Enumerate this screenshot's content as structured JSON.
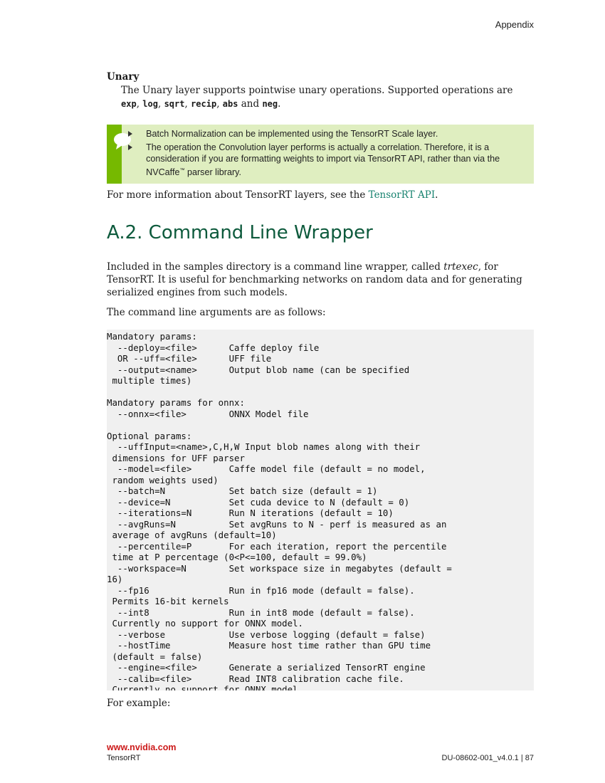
{
  "header": {
    "section": "Appendix"
  },
  "unary": {
    "title": "Unary",
    "text_before": "The Unary layer supports pointwise unary operations. Supported operations are ",
    "ops": [
      "exp",
      "log",
      "sqrt",
      "recip",
      "abs",
      "neg"
    ],
    "sep_1": ", ",
    "sep_2": ", ",
    "sep_3": ", ",
    "sep_4": ", ",
    "sep_and": " and ",
    "text_end": "."
  },
  "note": {
    "icon": "speech-bubble-icon",
    "colors": {
      "side": "#76b900",
      "background": "#dfeec0"
    },
    "bullet_1": "Batch Normalization can be implemented using the TensorRT Scale layer.",
    "bullet_2_before": "The operation the Convolution layer performs is actually a correlation. Therefore, it is a consideration if you are formatting weights to import via TensorRT API, rather than via the NVCaffe",
    "bullet_2_tm": "™",
    "bullet_2_after": " parser library."
  },
  "more_info": {
    "text": "For more information about TensorRT layers, see the ",
    "link": "TensorRT API",
    "end": "."
  },
  "section": {
    "title": "A.2. Command Line Wrapper",
    "intro_before": "Included in the samples directory is a command line wrapper, called ",
    "intro_tool": "trtexec",
    "intro_after": ", for TensorRT. It is useful for benchmarking networks on random data and for generating serialized engines from such models.",
    "args_intro": "The command line arguments are as follows:",
    "code": "Mandatory params:\n  --deploy=<file>      Caffe deploy file\n  OR --uff=<file>      UFF file\n  --output=<name>      Output blob name (can be specified\n multiple times)\n\nMandatory params for onnx:\n  --onnx=<file>        ONNX Model file\n\nOptional params:\n  --uffInput=<name>,C,H,W Input blob names along with their\n dimensions for UFF parser\n  --model=<file>       Caffe model file (default = no model,\n random weights used)\n  --batch=N            Set batch size (default = 1)\n  --device=N           Set cuda device to N (default = 0)\n  --iterations=N       Run N iterations (default = 10)\n  --avgRuns=N          Set avgRuns to N - perf is measured as an\n average of avgRuns (default=10)\n  --percentile=P       For each iteration, report the percentile\n time at P percentage (0<P<=100, default = 99.0%)\n  --workspace=N        Set workspace size in megabytes (default =\n16)\n  --fp16               Run in fp16 mode (default = false).\n Permits 16-bit kernels\n  --int8               Run in int8 mode (default = false).\n Currently no support for ONNX model.\n  --verbose            Use verbose logging (default = false)\n  --hostTime           Measure host time rather than GPU time\n (default = false)\n  --engine=<file>      Generate a serialized TensorRT engine\n  --calib=<file>       Read INT8 calibration cache file.\n Currently no support for ONNX model.",
    "example": "For example:"
  },
  "footer": {
    "site": "www.nvidia.com",
    "product": "TensorRT",
    "doc_id": "DU-08602-001_v4.0.1",
    "separator": " | ",
    "page": "87"
  }
}
